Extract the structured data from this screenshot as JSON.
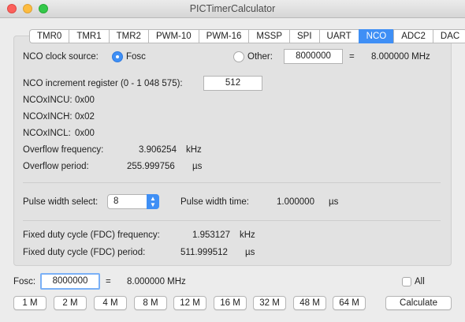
{
  "window": {
    "title": "PICTimerCalculator"
  },
  "tabs": [
    {
      "label": "TMR0"
    },
    {
      "label": "TMR1"
    },
    {
      "label": "TMR2"
    },
    {
      "label": "PWM-10"
    },
    {
      "label": "PWM-16"
    },
    {
      "label": "MSSP"
    },
    {
      "label": "SPI"
    },
    {
      "label": "UART"
    },
    {
      "label": "NCO",
      "active": true
    },
    {
      "label": "ADC2"
    },
    {
      "label": "DAC"
    }
  ],
  "nco": {
    "clock_source_label": "NCO clock source:",
    "fosc_option": "Fosc",
    "other_option": "Other:",
    "other_value": "8000000",
    "equals": "=",
    "other_result": "8.000000 MHz",
    "increment_label": "NCO increment register (0 - 1 048 575):",
    "increment_value": "512",
    "incu_label": "NCOxINCU:",
    "incu_value": "0x00",
    "inch_label": "NCOxINCH:",
    "inch_value": "0x02",
    "incl_label": "NCOxINCL:",
    "incl_value": "0x00",
    "overflow_freq_label": "Overflow frequency:",
    "overflow_freq_value": "3.906254",
    "overflow_freq_unit": "kHz",
    "overflow_period_label": "Overflow period:",
    "overflow_period_value": "255.999756",
    "overflow_period_unit": "µs",
    "pulse_select_label": "Pulse width select:",
    "pulse_select_value": "8",
    "pulse_time_label": "Pulse width time:",
    "pulse_time_value": "1.000000",
    "pulse_time_unit": "µs",
    "fdc_freq_label": "Fixed duty cycle (FDC) frequency:",
    "fdc_freq_value": "1.953127",
    "fdc_freq_unit": "kHz",
    "fdc_period_label": "Fixed duty cycle (FDC) period:",
    "fdc_period_value": "511.999512",
    "fdc_period_unit": "µs"
  },
  "footer": {
    "fosc_label": "Fosc:",
    "fosc_value": "8000000",
    "equals": "=",
    "fosc_result": "8.000000 MHz",
    "all_label": "All",
    "presets": [
      "1 M",
      "2 M",
      "4 M",
      "8 M",
      "12 M",
      "16 M",
      "32 M",
      "48 M",
      "64 M"
    ],
    "calculate_label": "Calculate"
  },
  "colors": {
    "accent": "#3f8ff5",
    "panel": "#e2e2e2",
    "window": "#ececec"
  }
}
